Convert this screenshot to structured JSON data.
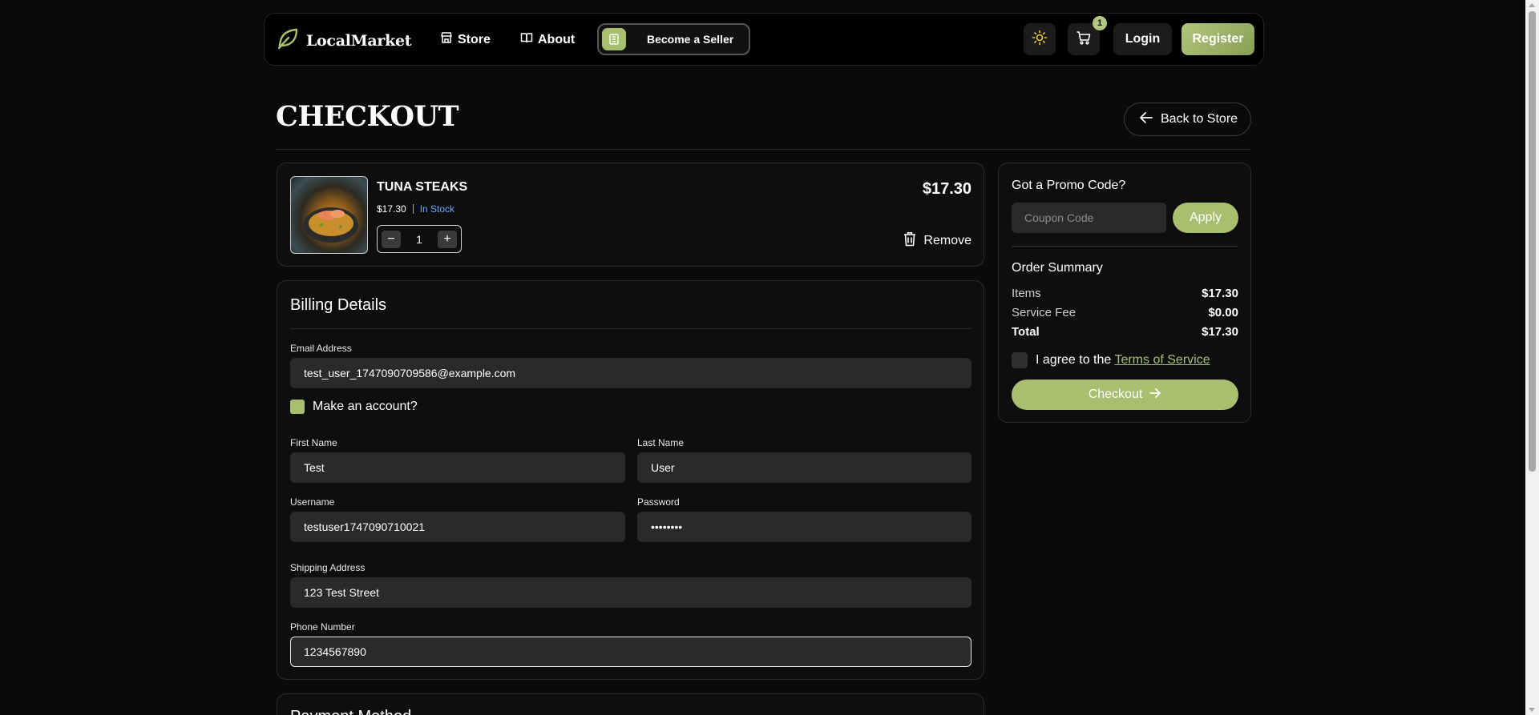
{
  "nav": {
    "brand": "LocalMarket",
    "store_label": "Store",
    "about_label": "About",
    "seller_label": "Become a Seller",
    "cart_count": "1",
    "login_label": "Login",
    "register_label": "Register"
  },
  "page": {
    "title": "CHECKOUT",
    "back_label": "Back to Store"
  },
  "cart_item": {
    "name": "TUNA STEAKS",
    "unit_price": "$17.30",
    "stock_status": "In Stock",
    "quantity": "1",
    "line_total": "$17.30",
    "remove_label": "Remove"
  },
  "billing": {
    "title": "Billing Details",
    "email_label": "Email Address",
    "email_value": "test_user_1747090709586@example.com",
    "make_account_label": "Make an account?",
    "first_name_label": "First Name",
    "first_name_value": "Test",
    "last_name_label": "Last Name",
    "last_name_value": "User",
    "username_label": "Username",
    "username_value": "testuser1747090710021",
    "password_label": "Password",
    "password_value": "••••••••",
    "shipping_label": "Shipping Address",
    "shipping_value": "123 Test Street",
    "phone_label": "Phone Number",
    "phone_value": "1234567890"
  },
  "payment": {
    "title": "Payment Method"
  },
  "summary": {
    "promo_title": "Got a Promo Code?",
    "coupon_placeholder": "Coupon Code",
    "apply_label": "Apply",
    "title": "Order Summary",
    "items_label": "Items",
    "items_value": "$17.30",
    "fee_label": "Service Fee",
    "fee_value": "$0.00",
    "total_label": "Total",
    "total_value": "$17.30",
    "agree_prefix": "I agree to the",
    "tos_label": "Terms of Service",
    "checkout_label": "Checkout"
  },
  "colors": {
    "accent": "#a8bf70",
    "background": "#0a0a0a",
    "field": "#2a2a2a",
    "link_blue": "#6fa6ff"
  }
}
